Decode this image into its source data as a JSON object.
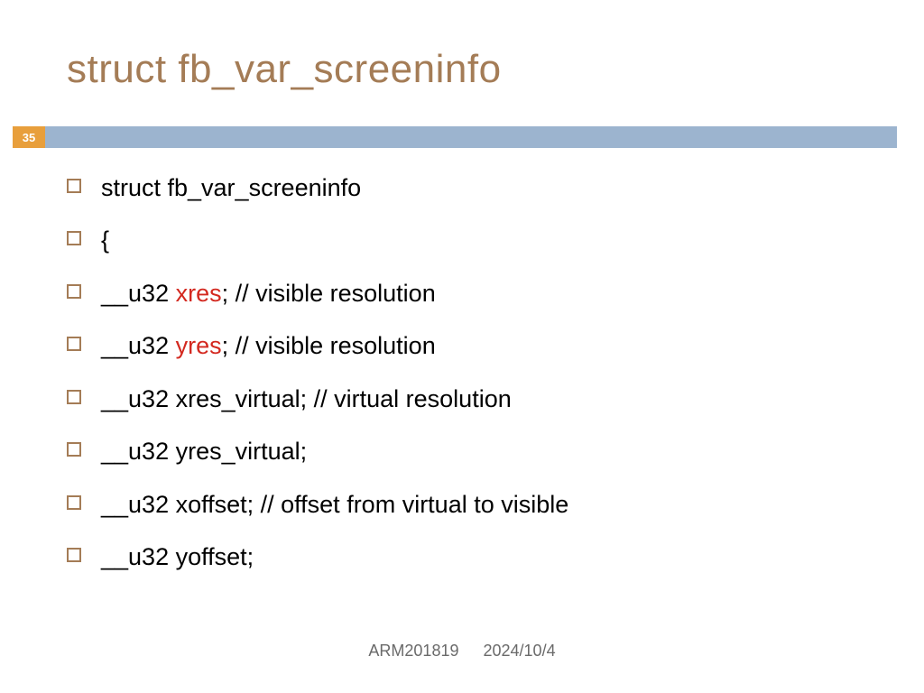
{
  "title": "struct fb_var_screeninfo",
  "page_number": "35",
  "lines": [
    {
      "prefix": "struct fb_var_screeninfo",
      "red": "",
      "suffix": ""
    },
    {
      "prefix": "{",
      "red": "",
      "suffix": ""
    },
    {
      "prefix": "__u32 ",
      "red": "xres",
      "suffix": "; // visible resolution"
    },
    {
      "prefix": "__u32 ",
      "red": "yres",
      "suffix": "; // visible resolution"
    },
    {
      "prefix": "__u32 xres_virtual; // virtual resolution",
      "red": "",
      "suffix": ""
    },
    {
      "prefix": "__u32 yres_virtual;",
      "red": "",
      "suffix": ""
    },
    {
      "prefix": "__u32 xoffset; // offset from virtual to visible",
      "red": "",
      "suffix": ""
    },
    {
      "prefix": "__u32 yoffset;",
      "red": "",
      "suffix": ""
    }
  ],
  "footer": {
    "course": "ARM201819",
    "date": "2024/10/4"
  }
}
